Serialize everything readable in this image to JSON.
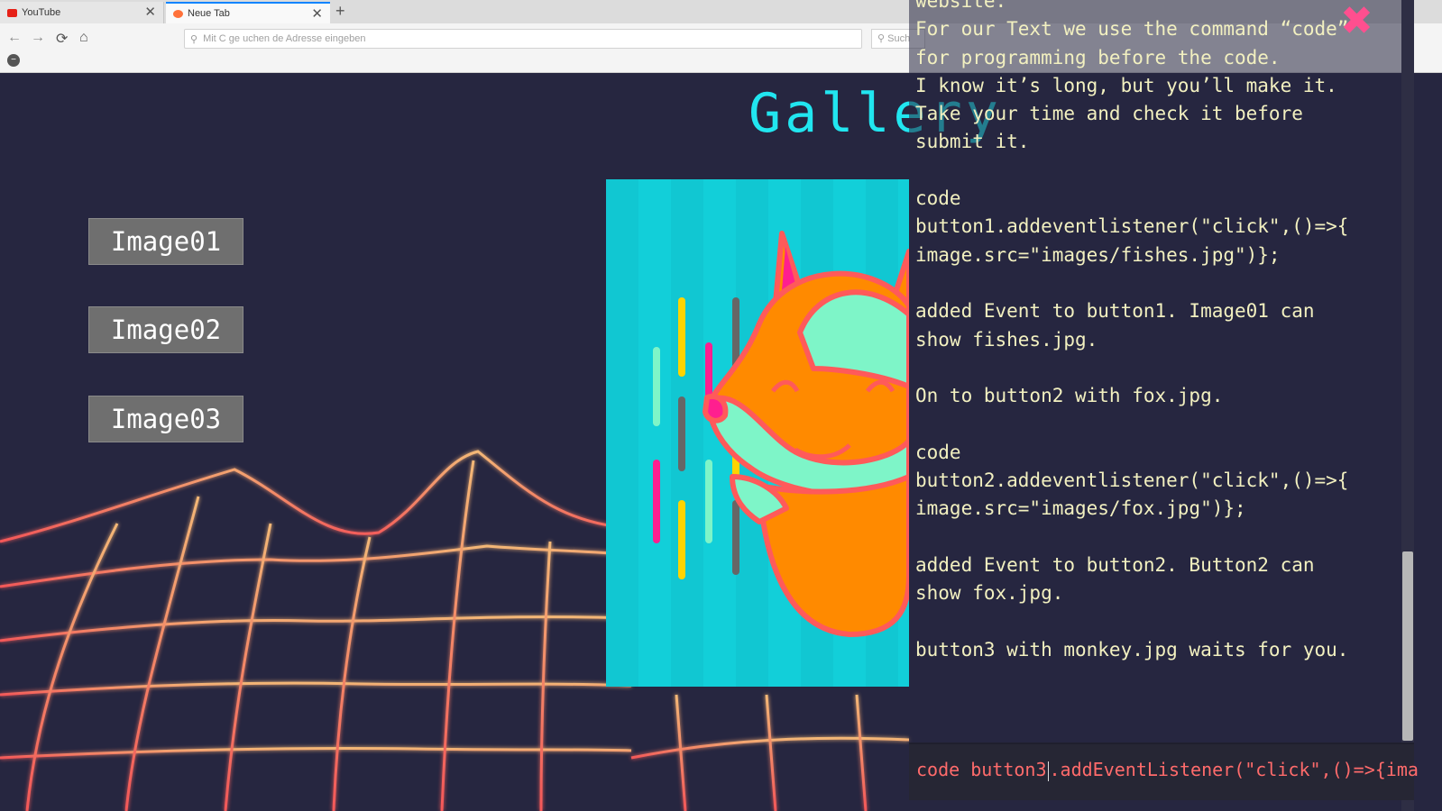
{
  "browser": {
    "tabs": [
      {
        "label": "YouTube",
        "favicon_color": "#e62117"
      },
      {
        "label": "Neue Tab",
        "favicon_color": "#ff7139"
      }
    ],
    "url_placeholder": "Mit C   ge   uchen   de   Adresse eingeben",
    "search_placeholder": "Such"
  },
  "page": {
    "title": "Gallery",
    "buttons": [
      {
        "label": "Image01"
      },
      {
        "label": "Image02"
      },
      {
        "label": "Image03"
      }
    ],
    "picture": {
      "subject": "fox",
      "bg_color": "#12cfd9"
    }
  },
  "panel": {
    "lines": [
      "website.",
      "For our Text we use the command “code”",
      "for programming before the code.",
      "I know it’s long, but you’ll make it.",
      "Take your time and check it before",
      "submit it.",
      "",
      "code",
      "button1.addeventlistener(\"click\",()=>{",
      "image.src=\"images/fishes.jpg\")};",
      "",
      "added Event to button1. Image01 can",
      "show fishes.jpg.",
      "",
      "On to button2 with fox.jpg.",
      "",
      "code",
      "button2.addeventlistener(\"click\",()=>{",
      "image.src=\"images/fox.jpg\")};",
      "",
      "added Event to button2. Button2 can",
      "show fox.jpg.",
      "",
      "button3 with monkey.jpg waits for you."
    ],
    "command_before_caret": "code button3",
    "command_after_caret": ".addEventListener(\"click\",()=>{ima"
  },
  "colors": {
    "title": "#21e6f0",
    "panel_text": "#f2f0c0",
    "command_text": "#ff6b6b",
    "close_icon": "#ff4f8f",
    "button_bg": "#6f6f6f",
    "page_bg": "#262640"
  }
}
